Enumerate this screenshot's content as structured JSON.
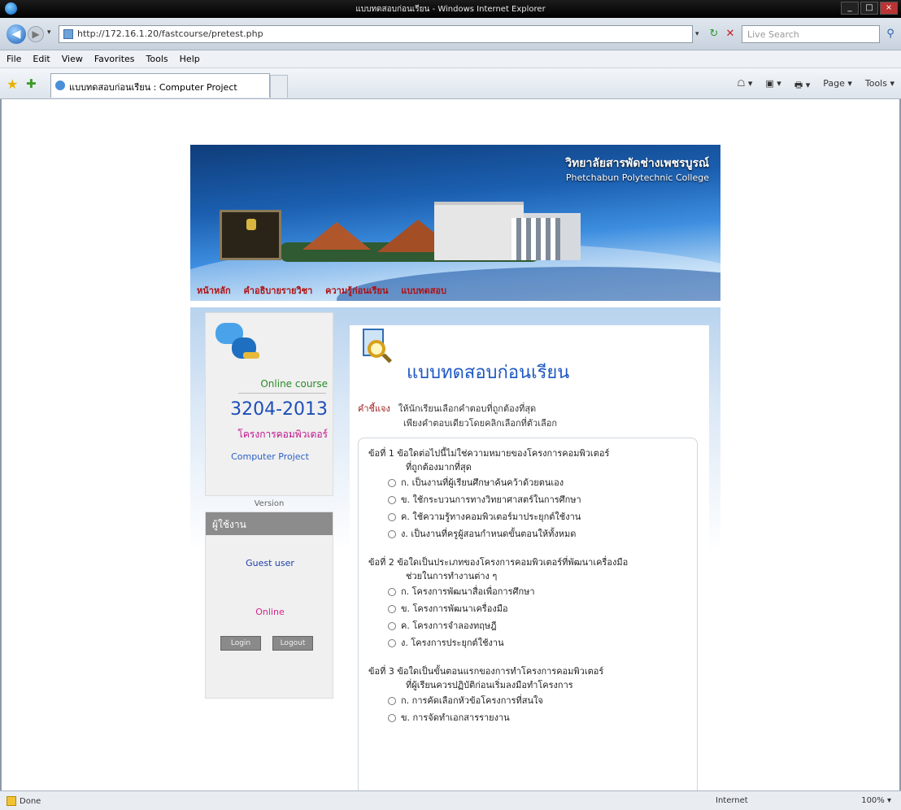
{
  "browser": {
    "window_title": "แบบทดสอบก่อนเรียน - Windows Internet Explorer",
    "url": "http://172.16.1.20/fastcourse/pretest.php",
    "search_placeholder": "Live Search",
    "menu": [
      "File",
      "Edit",
      "View",
      "Favorites",
      "Tools",
      "Help"
    ],
    "tab_label": "แบบทดสอบก่อนเรียน : Computer Project",
    "tools": [
      "☖ ▾",
      "▣ ▾",
      "🖶 ▾",
      "Page ▾",
      "Tools ▾"
    ],
    "status_text": "Done",
    "status_zone": "Internet",
    "status_zoom": "100% ▾"
  },
  "banner": {
    "college_th": "วิทยาลัยสารพัดช่างเพชรบูรณ์",
    "college_en": "Phetchabun Polytechnic College"
  },
  "nav": [
    "หน้าหลัก",
    "คำอธิบายรายวิชา",
    "ความรู้ก่อนเรียน",
    "แบบทดสอบ"
  ],
  "sidebar": {
    "label": "Online course",
    "course_code": "3204-2013",
    "course_name_th": "โครงการคอมพิวเตอร์",
    "course_name_en": "Computer Project",
    "version": "Version",
    "login_title": "ผู้ใช้งาน",
    "user": "Guest user",
    "status": "Online",
    "login_label": "Login",
    "logout_label": "Logout"
  },
  "main": {
    "title": "แบบทดสอบก่อนเรียน",
    "instruction_label": "คำชี้แจง",
    "instruction_1": "ให้นักเรียนเลือกคำตอบที่ถูกต้องที่สุด",
    "instruction_2": "เพียงคำตอบเดียวโดยคลิกเลือกที่ตัวเลือก",
    "questions": [
      {
        "text": "ข้อที่ 1 ข้อใดต่อไปนี้ไม่ใช่ความหมายของโครงการคอมพิวเตอร์",
        "text_cont": "ที่ถูกต้องมากที่สุด",
        "options": [
          "ก. เป็นงานที่ผู้เรียนศึกษาค้นคว้าด้วยตนเอง",
          "ข. ใช้กระบวนการทางวิทยาศาสตร์ในการศึกษา",
          "ค. ใช้ความรู้ทางคอมพิวเตอร์มาประยุกต์ใช้งาน",
          "ง. เป็นงานที่ครูผู้สอนกำหนดขั้นตอนให้ทั้งหมด"
        ]
      },
      {
        "text": "ข้อที่ 2 ข้อใดเป็นประเภทของโครงการคอมพิวเตอร์ที่พัฒนาเครื่องมือ",
        "text_cont": "ช่วยในการทำงานต่าง ๆ",
        "options": [
          "ก. โครงการพัฒนาสื่อเพื่อการศึกษา",
          "ข. โครงการพัฒนาเครื่องมือ",
          "ค. โครงการจำลองทฤษฎี",
          "ง. โครงการประยุกต์ใช้งาน"
        ]
      },
      {
        "text": "ข้อที่ 3 ข้อใดเป็นขั้นตอนแรกของการทำโครงการคอมพิวเตอร์",
        "text_cont": "ที่ผู้เรียนควรปฏิบัติก่อนเริ่มลงมือทำโครงการ",
        "options": [
          "ก. การคัดเลือกหัวข้อโครงการที่สนใจ",
          "ข. การจัดทำเอกสารรายงาน"
        ]
      }
    ]
  }
}
